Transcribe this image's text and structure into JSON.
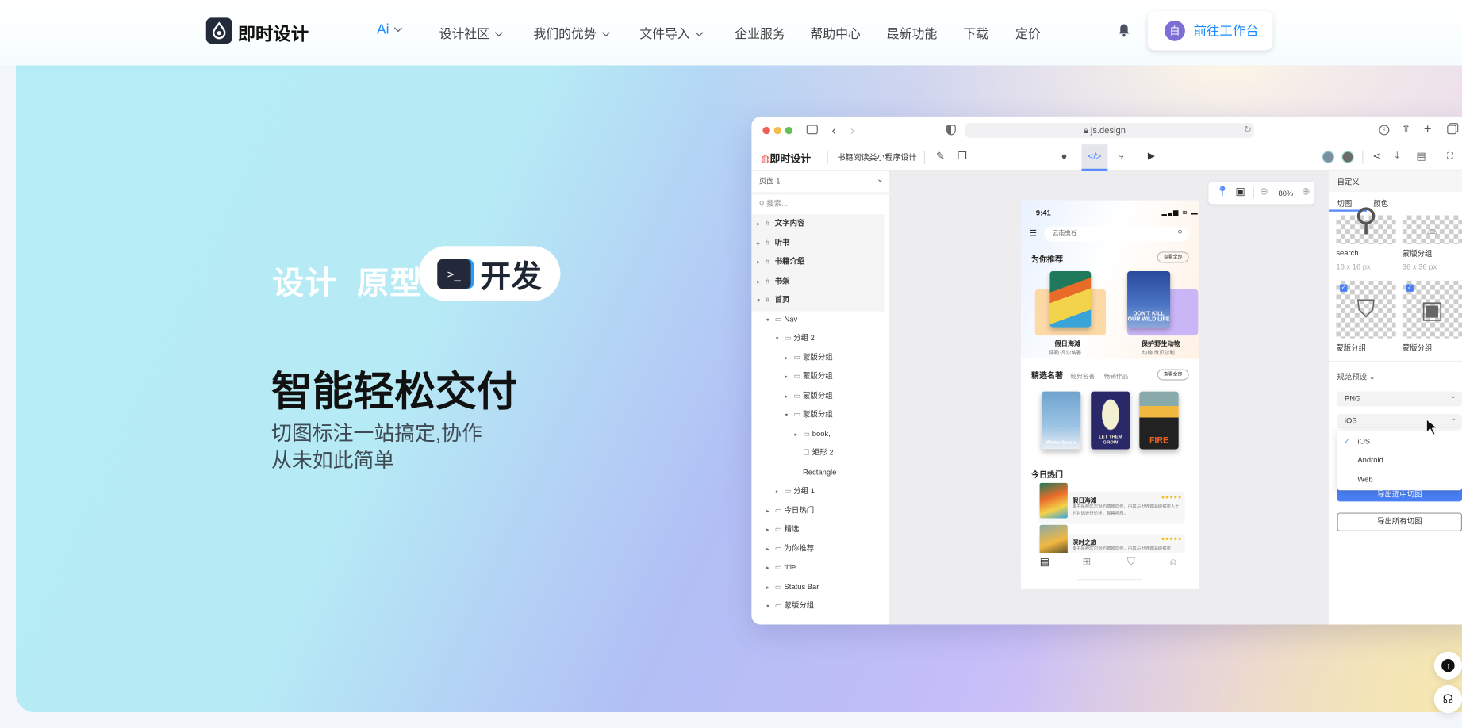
{
  "nav": {
    "brand": "即时设计",
    "items": [
      {
        "label": "Ai",
        "dropdown": true
      },
      {
        "label": "设计社区",
        "dropdown": true
      },
      {
        "label": "我们的优势",
        "dropdown": true
      },
      {
        "label": "文件导入",
        "dropdown": true
      },
      {
        "label": "企业服务",
        "dropdown": false
      },
      {
        "label": "帮助中心",
        "dropdown": false
      },
      {
        "label": "最新功能",
        "dropdown": false
      },
      {
        "label": "下载",
        "dropdown": false
      },
      {
        "label": "定价",
        "dropdown": false
      }
    ],
    "bell_icon": "bell-icon",
    "workspace_button": {
      "avatar": "白",
      "label": "前往工作台"
    },
    "accent": "#1a8cff"
  },
  "hero": {
    "tag_design": "设计",
    "tag_prototype": "原型",
    "tag_dev": "开发",
    "terminal_glyph": ">_",
    "title": "智能轻松交付",
    "subtitle_line1": "切图标注一站搞定,协作",
    "subtitle_line2": "从未如此简单"
  },
  "browser": {
    "url": "js.design",
    "app_brand": "即时设计",
    "file_name": "书籍阅读类小程序设计",
    "layers_header": "页面 1",
    "search_placeholder": "搜索...",
    "layers": [
      {
        "label": "文字内容",
        "level": 0,
        "type": "frame",
        "expanded": false
      },
      {
        "label": "听书",
        "level": 0,
        "type": "frame",
        "expanded": false
      },
      {
        "label": "书籍介绍",
        "level": 0,
        "type": "frame",
        "expanded": false
      },
      {
        "label": "书架",
        "level": 0,
        "type": "frame",
        "expanded": false
      },
      {
        "label": "首页",
        "level": 0,
        "type": "frame",
        "expanded": true
      },
      {
        "label": "Nav",
        "level": 1,
        "type": "group",
        "expanded": true
      },
      {
        "label": "分组 2",
        "level": 2,
        "type": "group",
        "expanded": true
      },
      {
        "label": "蒙版分组",
        "level": 3,
        "type": "group",
        "expanded": false
      },
      {
        "label": "蒙版分组",
        "level": 3,
        "type": "group",
        "expanded": false
      },
      {
        "label": "蒙版分组",
        "level": 3,
        "type": "group",
        "expanded": false
      },
      {
        "label": "蒙版分组",
        "level": 3,
        "type": "group",
        "expanded": true
      },
      {
        "label": "book,",
        "level": 4,
        "type": "group",
        "expanded": false
      },
      {
        "label": "矩形 2",
        "level": 4,
        "type": "rect",
        "expanded": null
      },
      {
        "label": "Rectangle",
        "level": 3,
        "type": "line",
        "expanded": null
      },
      {
        "label": "分组 1",
        "level": 2,
        "type": "group",
        "expanded": false
      },
      {
        "label": "今日热门",
        "level": 1,
        "type": "group",
        "expanded": false
      },
      {
        "label": "精选",
        "level": 1,
        "type": "group",
        "expanded": false
      },
      {
        "label": "为你推荐",
        "level": 1,
        "type": "group",
        "expanded": false
      },
      {
        "label": "title",
        "level": 1,
        "type": "group",
        "expanded": false
      },
      {
        "label": "Status Bar",
        "level": 1,
        "type": "group",
        "expanded": false
      },
      {
        "label": "蒙版分组",
        "level": 1,
        "type": "group",
        "expanded": true
      }
    ],
    "zoom": "80%",
    "phone": {
      "time": "9:41",
      "search": "云南虫谷",
      "section1": "为你推荐",
      "see_all": "查看全部",
      "rec": [
        {
          "title": "假日海滩",
          "author": "儒勒·凡尔纳著",
          "card_color": "#fdd9a6"
        },
        {
          "title": "保护野生动物",
          "author": "约翰·欣贝尔利",
          "card_color": "#c9b6f7",
          "art": "DON'T KILL OUR WILD LIFE"
        }
      ],
      "section2": "精选名著",
      "section2_tabs": [
        "经典名著",
        "畅销作品"
      ],
      "featured_art": [
        "Winter Sports",
        "LET THEM GROW",
        "FIRE"
      ],
      "section3": "今日热门",
      "hot": [
        {
          "title": "假日海滩",
          "stars": "★★★★★",
          "desc": "本书是校区尔对的精神向传，由其与世界各国域搭雾人士的对话进行论述，颇具特质。"
        },
        {
          "title": "深时之旅",
          "stars": "★★★★★",
          "desc": "本书是校区尔对的精神向传，由其与世界各国域搭雾"
        }
      ]
    },
    "right_panel": {
      "header": "自定义",
      "tabs": [
        "切图",
        "颜色"
      ],
      "slices": [
        {
          "name": "search",
          "size": "16 x 16 px",
          "checked": false
        },
        {
          "name": "蒙版分组",
          "size": "36 x 36 px",
          "checked": false
        },
        {
          "name": "蒙版分组",
          "checked": true
        },
        {
          "name": "蒙版分组",
          "checked": true
        }
      ],
      "preset_label": "规范预设",
      "format": "PNG",
      "platform": "iOS",
      "platform_options": [
        "iOS",
        "Android",
        "Web"
      ],
      "export_selected": "导出选中切图",
      "export_all": "导出所有切图",
      "accent": "#4a80f5"
    }
  },
  "floating": {
    "top_icon": "arrow-up-icon",
    "support_icon": "headset-icon"
  }
}
